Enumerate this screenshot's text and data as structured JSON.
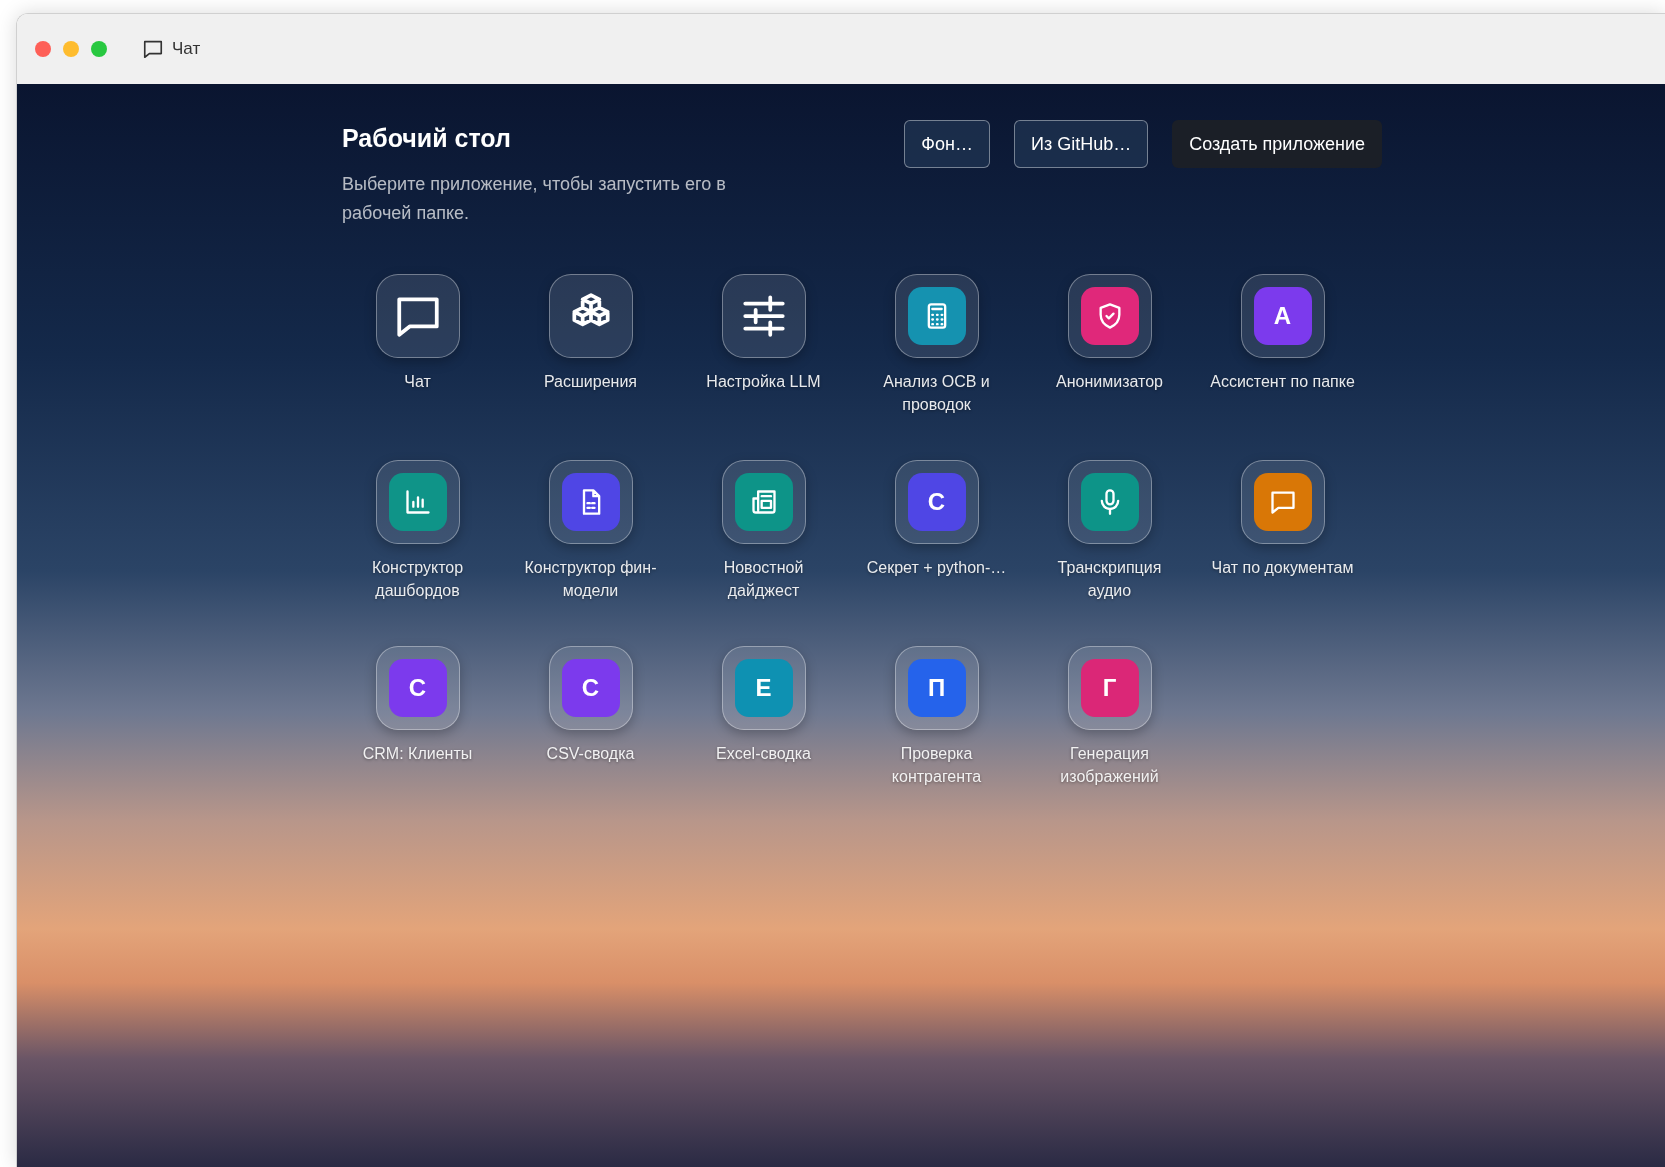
{
  "window": {
    "tab_title": "Чат"
  },
  "header": {
    "title": "Рабочий стол",
    "subtitle": "Выберите приложение, чтобы запустить его в рабочей папке.",
    "buttons": [
      {
        "label": "Фон…",
        "kind": "outline"
      },
      {
        "label": "Из GitHub…",
        "kind": "outline"
      },
      {
        "label": "Создать приложение",
        "kind": "primary"
      }
    ]
  },
  "apps": [
    {
      "label": "Чат",
      "kind": "glyph"
    },
    {
      "label": "Расширения",
      "kind": "glyph"
    },
    {
      "label": "Настройка LLM",
      "kind": "glyph"
    },
    {
      "label": "Анализ ОСВ и проводок",
      "kind": "tile",
      "color": "#1592b0"
    },
    {
      "label": "Анонимизатор",
      "kind": "tile",
      "color": "#e0287a"
    },
    {
      "label": "Ассистент по папке",
      "kind": "letter",
      "letter": "A",
      "color": "#7c3aed"
    },
    {
      "label": "Конструктор дашбордов",
      "kind": "tile",
      "color": "#0f9488"
    },
    {
      "label": "Конструктор фин-модели",
      "kind": "tile",
      "color": "#4f46e5"
    },
    {
      "label": "Новостной дайджест",
      "kind": "tile",
      "color": "#0d9488"
    },
    {
      "label": "Секрет + python-…",
      "kind": "letter",
      "letter": "C",
      "color": "#4f46e5"
    },
    {
      "label": "Транскрипция аудио",
      "kind": "tile",
      "color": "#0d9488"
    },
    {
      "label": "Чат по документам",
      "kind": "tile",
      "color": "#d97706"
    },
    {
      "label": "CRM: Клиенты",
      "kind": "letter",
      "letter": "C",
      "color": "#7c3aed"
    },
    {
      "label": "CSV-сводка",
      "kind": "letter",
      "letter": "C",
      "color": "#7c3aed"
    },
    {
      "label": "Excel-сводка",
      "kind": "letter",
      "letter": "E",
      "color": "#0e91b2"
    },
    {
      "label": "Проверка контрагента",
      "kind": "letter",
      "letter": "П",
      "color": "#2563eb"
    },
    {
      "label": "Генерация изображений",
      "kind": "letter",
      "letter": "Г",
      "color": "#db2777"
    }
  ]
}
